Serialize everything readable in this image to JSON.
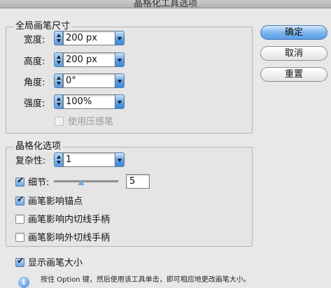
{
  "window": {
    "title": "晶格化工具选项"
  },
  "brush_size_group": {
    "legend": "全局画笔尺寸",
    "width": {
      "label": "宽度:",
      "value": "200 px"
    },
    "height": {
      "label": "高度:",
      "value": "200 px"
    },
    "angle": {
      "label": "角度:",
      "value": "0°"
    },
    "strength": {
      "label": "强度:",
      "value": "100%"
    },
    "use_pressure": {
      "label": "使用压感笔",
      "checked": false,
      "enabled": false
    }
  },
  "crystallize_group": {
    "legend": "晶格化选项",
    "complexity": {
      "label": "复杂性:",
      "value": "1"
    },
    "detail": {
      "label": "细节:",
      "checked": true,
      "value": "5",
      "slider_fraction": 0.25
    },
    "brush_affects_anchors": {
      "label": "画笔影响锚点",
      "checked": true
    },
    "brush_affects_in_tangents": {
      "label": "画笔影响内切线手柄",
      "checked": false
    },
    "brush_affects_out_tangents": {
      "label": "画笔影响外切线手柄",
      "checked": false
    }
  },
  "show_brush_size": {
    "label": "显示画笔大小",
    "checked": true
  },
  "hint": {
    "text": "按住 Option 键，然后使用该工具单击，即可相应地更改画笔大小。"
  },
  "buttons": {
    "ok": "确定",
    "cancel": "取消",
    "reset": "重置"
  }
}
